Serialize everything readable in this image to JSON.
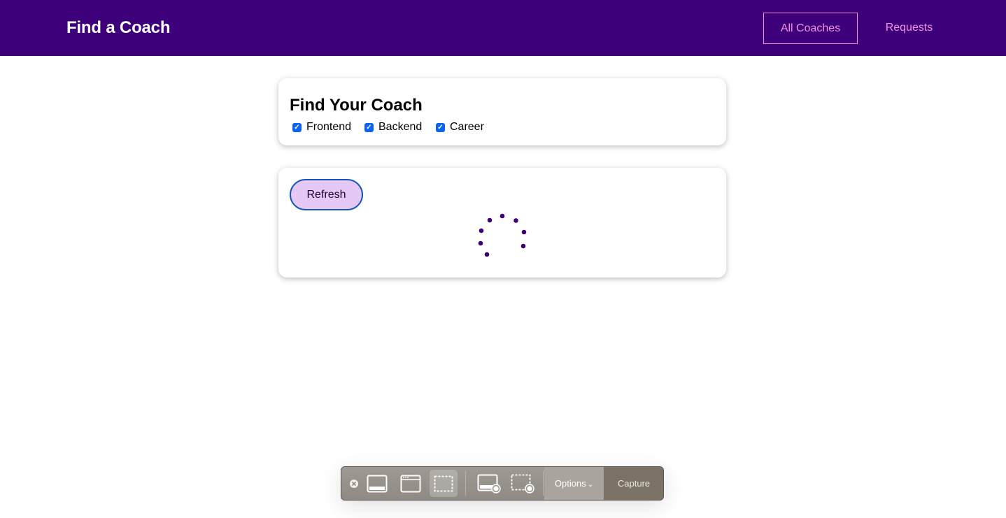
{
  "header": {
    "brand": "Find a Coach",
    "nav": [
      {
        "label": "All Coaches",
        "active": true
      },
      {
        "label": "Requests",
        "active": false
      }
    ],
    "colors": {
      "background": "#3d007a",
      "link": "#f391e3"
    }
  },
  "filter": {
    "title": "Find Your Coach",
    "options": [
      {
        "label": "Frontend",
        "checked": true
      },
      {
        "label": "Backend",
        "checked": true
      },
      {
        "label": "Career",
        "checked": true
      }
    ]
  },
  "coach_list": {
    "refresh_label": "Refresh",
    "loading": true,
    "spinner_icon": "loading-spinner-icon",
    "spinner_color": "#3d007a"
  },
  "screenshot_toolbar": {
    "buttons": [
      {
        "name": "close-icon"
      },
      {
        "name": "capture-entire-screen-icon"
      },
      {
        "name": "capture-window-icon"
      },
      {
        "name": "capture-selection-icon",
        "selected": true
      },
      {
        "name": "record-entire-screen-icon"
      },
      {
        "name": "record-selection-icon"
      }
    ],
    "options_label": "Options",
    "capture_label": "Capture"
  }
}
